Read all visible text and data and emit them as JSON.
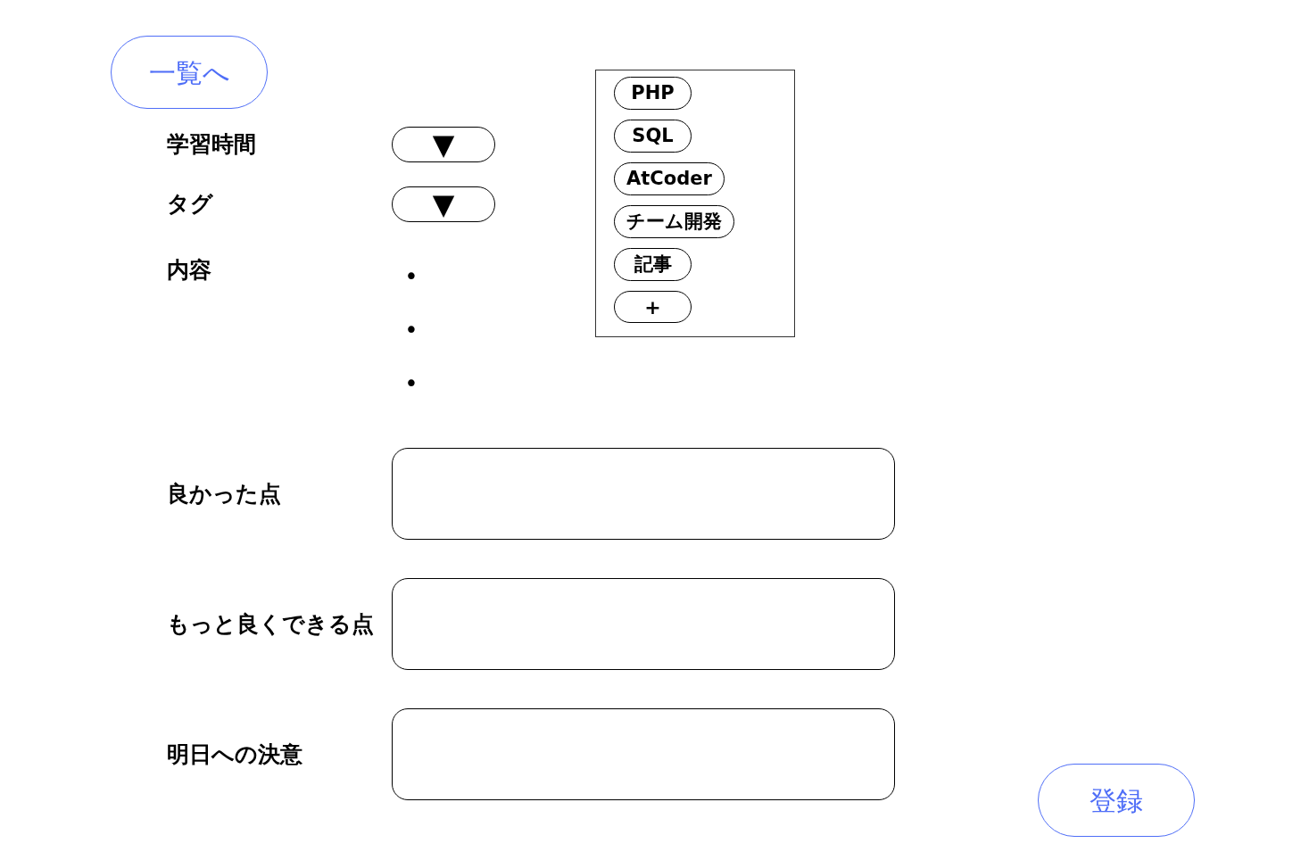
{
  "back_button": {
    "label": "一覧へ"
  },
  "fields": [
    {
      "kind": "dropdown",
      "label": "学習時間",
      "arrow": "▼"
    },
    {
      "kind": "dropdown",
      "label": "タグ",
      "arrow": "▼"
    },
    {
      "kind": "bullets",
      "label": "内容",
      "bullets": [
        "•",
        "•",
        "•"
      ]
    }
  ],
  "tag_list": {
    "tags": [
      "PHP",
      "SQL",
      "AtCoder",
      "チーム開発",
      "記事"
    ],
    "add_button": "+"
  },
  "reflections": [
    {
      "label": "良かった点"
    },
    {
      "label": "もっと良くできる点"
    },
    {
      "label": "明日への決意"
    }
  ],
  "submit_button": {
    "label": "登録"
  }
}
